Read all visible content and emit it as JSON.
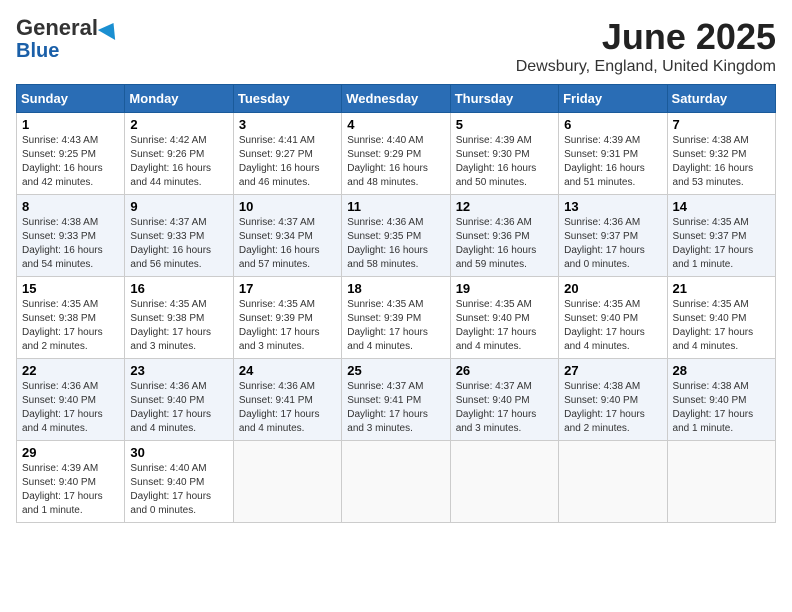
{
  "header": {
    "logo_general": "General",
    "logo_blue": "Blue",
    "month_title": "June 2025",
    "location": "Dewsbury, England, United Kingdom"
  },
  "days_of_week": [
    "Sunday",
    "Monday",
    "Tuesday",
    "Wednesday",
    "Thursday",
    "Friday",
    "Saturday"
  ],
  "weeks": [
    [
      {
        "day": "1",
        "sunrise": "Sunrise: 4:43 AM",
        "sunset": "Sunset: 9:25 PM",
        "daylight": "Daylight: 16 hours and 42 minutes."
      },
      {
        "day": "2",
        "sunrise": "Sunrise: 4:42 AM",
        "sunset": "Sunset: 9:26 PM",
        "daylight": "Daylight: 16 hours and 44 minutes."
      },
      {
        "day": "3",
        "sunrise": "Sunrise: 4:41 AM",
        "sunset": "Sunset: 9:27 PM",
        "daylight": "Daylight: 16 hours and 46 minutes."
      },
      {
        "day": "4",
        "sunrise": "Sunrise: 4:40 AM",
        "sunset": "Sunset: 9:29 PM",
        "daylight": "Daylight: 16 hours and 48 minutes."
      },
      {
        "day": "5",
        "sunrise": "Sunrise: 4:39 AM",
        "sunset": "Sunset: 9:30 PM",
        "daylight": "Daylight: 16 hours and 50 minutes."
      },
      {
        "day": "6",
        "sunrise": "Sunrise: 4:39 AM",
        "sunset": "Sunset: 9:31 PM",
        "daylight": "Daylight: 16 hours and 51 minutes."
      },
      {
        "day": "7",
        "sunrise": "Sunrise: 4:38 AM",
        "sunset": "Sunset: 9:32 PM",
        "daylight": "Daylight: 16 hours and 53 minutes."
      }
    ],
    [
      {
        "day": "8",
        "sunrise": "Sunrise: 4:38 AM",
        "sunset": "Sunset: 9:33 PM",
        "daylight": "Daylight: 16 hours and 54 minutes."
      },
      {
        "day": "9",
        "sunrise": "Sunrise: 4:37 AM",
        "sunset": "Sunset: 9:33 PM",
        "daylight": "Daylight: 16 hours and 56 minutes."
      },
      {
        "day": "10",
        "sunrise": "Sunrise: 4:37 AM",
        "sunset": "Sunset: 9:34 PM",
        "daylight": "Daylight: 16 hours and 57 minutes."
      },
      {
        "day": "11",
        "sunrise": "Sunrise: 4:36 AM",
        "sunset": "Sunset: 9:35 PM",
        "daylight": "Daylight: 16 hours and 58 minutes."
      },
      {
        "day": "12",
        "sunrise": "Sunrise: 4:36 AM",
        "sunset": "Sunset: 9:36 PM",
        "daylight": "Daylight: 16 hours and 59 minutes."
      },
      {
        "day": "13",
        "sunrise": "Sunrise: 4:36 AM",
        "sunset": "Sunset: 9:37 PM",
        "daylight": "Daylight: 17 hours and 0 minutes."
      },
      {
        "day": "14",
        "sunrise": "Sunrise: 4:35 AM",
        "sunset": "Sunset: 9:37 PM",
        "daylight": "Daylight: 17 hours and 1 minute."
      }
    ],
    [
      {
        "day": "15",
        "sunrise": "Sunrise: 4:35 AM",
        "sunset": "Sunset: 9:38 PM",
        "daylight": "Daylight: 17 hours and 2 minutes."
      },
      {
        "day": "16",
        "sunrise": "Sunrise: 4:35 AM",
        "sunset": "Sunset: 9:38 PM",
        "daylight": "Daylight: 17 hours and 3 minutes."
      },
      {
        "day": "17",
        "sunrise": "Sunrise: 4:35 AM",
        "sunset": "Sunset: 9:39 PM",
        "daylight": "Daylight: 17 hours and 3 minutes."
      },
      {
        "day": "18",
        "sunrise": "Sunrise: 4:35 AM",
        "sunset": "Sunset: 9:39 PM",
        "daylight": "Daylight: 17 hours and 4 minutes."
      },
      {
        "day": "19",
        "sunrise": "Sunrise: 4:35 AM",
        "sunset": "Sunset: 9:40 PM",
        "daylight": "Daylight: 17 hours and 4 minutes."
      },
      {
        "day": "20",
        "sunrise": "Sunrise: 4:35 AM",
        "sunset": "Sunset: 9:40 PM",
        "daylight": "Daylight: 17 hours and 4 minutes."
      },
      {
        "day": "21",
        "sunrise": "Sunrise: 4:35 AM",
        "sunset": "Sunset: 9:40 PM",
        "daylight": "Daylight: 17 hours and 4 minutes."
      }
    ],
    [
      {
        "day": "22",
        "sunrise": "Sunrise: 4:36 AM",
        "sunset": "Sunset: 9:40 PM",
        "daylight": "Daylight: 17 hours and 4 minutes."
      },
      {
        "day": "23",
        "sunrise": "Sunrise: 4:36 AM",
        "sunset": "Sunset: 9:40 PM",
        "daylight": "Daylight: 17 hours and 4 minutes."
      },
      {
        "day": "24",
        "sunrise": "Sunrise: 4:36 AM",
        "sunset": "Sunset: 9:41 PM",
        "daylight": "Daylight: 17 hours and 4 minutes."
      },
      {
        "day": "25",
        "sunrise": "Sunrise: 4:37 AM",
        "sunset": "Sunset: 9:41 PM",
        "daylight": "Daylight: 17 hours and 3 minutes."
      },
      {
        "day": "26",
        "sunrise": "Sunrise: 4:37 AM",
        "sunset": "Sunset: 9:40 PM",
        "daylight": "Daylight: 17 hours and 3 minutes."
      },
      {
        "day": "27",
        "sunrise": "Sunrise: 4:38 AM",
        "sunset": "Sunset: 9:40 PM",
        "daylight": "Daylight: 17 hours and 2 minutes."
      },
      {
        "day": "28",
        "sunrise": "Sunrise: 4:38 AM",
        "sunset": "Sunset: 9:40 PM",
        "daylight": "Daylight: 17 hours and 1 minute."
      }
    ],
    [
      {
        "day": "29",
        "sunrise": "Sunrise: 4:39 AM",
        "sunset": "Sunset: 9:40 PM",
        "daylight": "Daylight: 17 hours and 1 minute."
      },
      {
        "day": "30",
        "sunrise": "Sunrise: 4:40 AM",
        "sunset": "Sunset: 9:40 PM",
        "daylight": "Daylight: 17 hours and 0 minutes."
      },
      null,
      null,
      null,
      null,
      null
    ]
  ]
}
